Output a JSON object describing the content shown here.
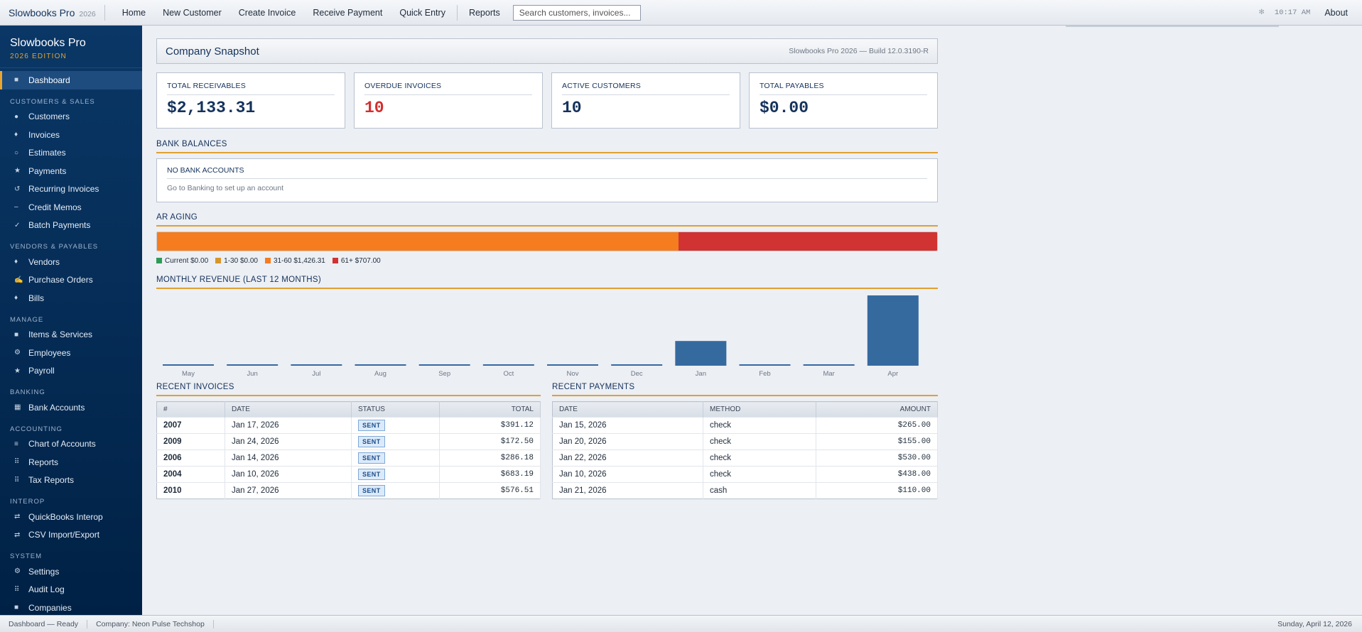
{
  "app": {
    "name": "Slowbooks Pro",
    "year": "2026"
  },
  "topbar": {
    "menu": [
      "Home",
      "New Customer",
      "Create Invoice",
      "Receive Payment",
      "Quick Entry",
      "Reports"
    ],
    "search_placeholder": "Search customers, invoices...",
    "clock": "10:17 AM",
    "about": "About"
  },
  "sidebar": {
    "title": "Slowbooks Pro",
    "edition": "2026 EDITION",
    "dashboard": {
      "label": "Dashboard",
      "icon": "square-icon"
    },
    "sections": [
      {
        "title": "Customers & Sales",
        "items": [
          {
            "label": "Customers",
            "icon": "circle-icon"
          },
          {
            "label": "Invoices",
            "icon": "diamond-icon"
          },
          {
            "label": "Estimates",
            "icon": "circle-outline-icon"
          },
          {
            "label": "Payments",
            "icon": "star-icon"
          },
          {
            "label": "Recurring Invoices",
            "icon": "refresh-icon"
          },
          {
            "label": "Credit Memos",
            "icon": "minus-icon"
          },
          {
            "label": "Batch Payments",
            "icon": "check-icon"
          }
        ]
      },
      {
        "title": "Vendors & Payables",
        "items": [
          {
            "label": "Vendors",
            "icon": "diamond-icon"
          },
          {
            "label": "Purchase Orders",
            "icon": "pen-icon"
          },
          {
            "label": "Bills",
            "icon": "diamond-icon"
          }
        ]
      },
      {
        "title": "Manage",
        "items": [
          {
            "label": "Items & Services",
            "icon": "square-icon"
          },
          {
            "label": "Employees",
            "icon": "gear-icon"
          },
          {
            "label": "Payroll",
            "icon": "star-icon"
          }
        ]
      },
      {
        "title": "Banking",
        "items": [
          {
            "label": "Bank Accounts",
            "icon": "grid-icon"
          }
        ]
      },
      {
        "title": "Accounting",
        "items": [
          {
            "label": "Chart of Accounts",
            "icon": "lines-icon"
          },
          {
            "label": "Reports",
            "icon": "dots-icon"
          },
          {
            "label": "Tax Reports",
            "icon": "dots-icon"
          }
        ]
      },
      {
        "title": "Interop",
        "items": [
          {
            "label": "QuickBooks Interop",
            "icon": "swap-icon"
          },
          {
            "label": "CSV Import/Export",
            "icon": "swap-icon"
          }
        ]
      },
      {
        "title": "System",
        "items": [
          {
            "label": "Settings",
            "icon": "gear-icon"
          },
          {
            "label": "Audit Log",
            "icon": "dots-icon"
          },
          {
            "label": "Companies",
            "icon": "square-icon"
          }
        ]
      }
    ]
  },
  "main": {
    "title": "Company Snapshot",
    "build": "Slowbooks Pro 2026 — Build 12.0.3190-R",
    "stats": [
      {
        "label": "TOTAL RECEIVABLES",
        "value": "$2,133.31",
        "color": "#14325c"
      },
      {
        "label": "OVERDUE INVOICES",
        "value": "10",
        "color": "#d32f2f"
      },
      {
        "label": "ACTIVE CUSTOMERS",
        "value": "10",
        "color": "#14325c"
      },
      {
        "label": "TOTAL PAYABLES",
        "value": "$0.00",
        "color": "#14325c"
      }
    ],
    "bank": {
      "section": "BANK BALANCES",
      "heading": "NO BANK ACCOUNTS",
      "sub": "Go to Banking to set up an account"
    },
    "aging": {
      "section": "AR AGING",
      "buckets": [
        {
          "label": "Current $0.00",
          "amount": 0,
          "color": "#2e9a57"
        },
        {
          "label": "1-30 $0.00",
          "amount": 0,
          "color": "#d8962a"
        },
        {
          "label": "31-60 $1,426.31",
          "amount": 1426.31,
          "color": "#f57c1f"
        },
        {
          "label": "61+ $707.00",
          "amount": 707.0,
          "color": "#d13232"
        }
      ]
    },
    "revenue_section": "MONTHLY REVENUE (LAST 12 MONTHS)",
    "invoices": {
      "section": "RECENT INVOICES",
      "headers": [
        "#",
        "DATE",
        "STATUS",
        "TOTAL"
      ],
      "rows": [
        {
          "num": "2007",
          "date": "Jan 17, 2026",
          "status": "SENT",
          "total": "$391.12"
        },
        {
          "num": "2009",
          "date": "Jan 24, 2026",
          "status": "SENT",
          "total": "$172.50"
        },
        {
          "num": "2006",
          "date": "Jan 14, 2026",
          "status": "SENT",
          "total": "$286.18"
        },
        {
          "num": "2004",
          "date": "Jan 10, 2026",
          "status": "SENT",
          "total": "$683.19"
        },
        {
          "num": "2010",
          "date": "Jan 27, 2026",
          "status": "SENT",
          "total": "$576.51"
        }
      ]
    },
    "payments": {
      "section": "RECENT PAYMENTS",
      "headers": [
        "DATE",
        "METHOD",
        "AMOUNT"
      ],
      "rows": [
        {
          "date": "Jan 15, 2026",
          "method": "check",
          "amount": "$265.00"
        },
        {
          "date": "Jan 20, 2026",
          "method": "check",
          "amount": "$155.00"
        },
        {
          "date": "Jan 22, 2026",
          "method": "check",
          "amount": "$530.00"
        },
        {
          "date": "Jan 10, 2026",
          "method": "check",
          "amount": "$438.00"
        },
        {
          "date": "Jan 21, 2026",
          "method": "cash",
          "amount": "$110.00"
        }
      ]
    }
  },
  "chart_data": {
    "type": "bar",
    "title": "MONTHLY REVENUE (LAST 12 MONTHS)",
    "categories": [
      "May",
      "Jun",
      "Jul",
      "Aug",
      "Sep",
      "Oct",
      "Nov",
      "Dec",
      "Jan",
      "Feb",
      "Mar",
      "Apr"
    ],
    "values": [
      0,
      0,
      0,
      0,
      0,
      0,
      0,
      0,
      2109,
      0,
      0,
      6000
    ],
    "bar_color": "#356a9f",
    "grid": false,
    "legend": "none"
  },
  "statusbar": {
    "status": "Dashboard — Ready",
    "company": "Company: Neon Pulse Techshop",
    "date": "Sunday, April 12, 2026"
  }
}
